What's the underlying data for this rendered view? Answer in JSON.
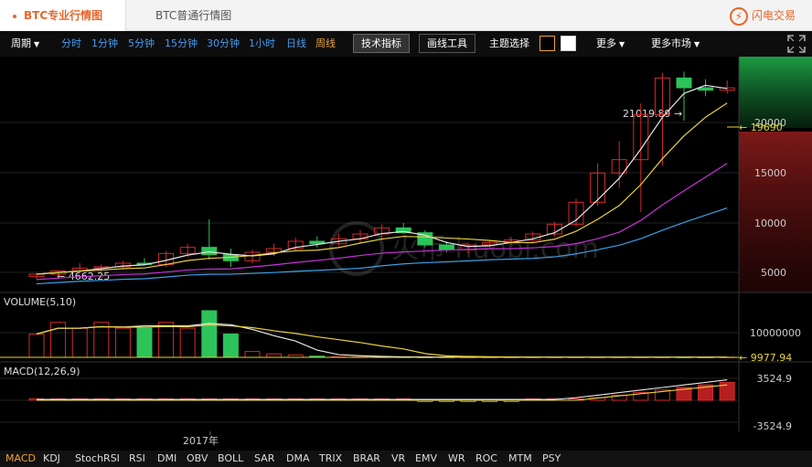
{
  "tabs": {
    "pro": "BTC专业行情图",
    "normal": "BTC普通行情图"
  },
  "flash_trade": {
    "icon": "flash-icon",
    "label": "闪电交易"
  },
  "toolbar": {
    "period_label": "周期",
    "periods": [
      "分时",
      "1分钟",
      "5分钟",
      "15分钟",
      "30分钟",
      "1小时",
      "日线",
      "周线"
    ],
    "active_period": "周线",
    "tech_indicator": "技术指标",
    "draw_tools": "画线工具",
    "theme_label": "主题选择",
    "more": "更多",
    "more_markets": "更多市场"
  },
  "colors": {
    "accent": "#e8662c",
    "up": "#d52a2a",
    "down": "#2cc35a",
    "ma1": "#e8e8e8",
    "ma2": "#e8d23a",
    "ma3": "#c832d8",
    "ma4": "#3aa0e8"
  },
  "price_panel": {
    "high_label": "21019.89",
    "low_label": "4662.25",
    "current_price": "19690",
    "axis_ticks": [
      "20000",
      "15000",
      "10000",
      "5000"
    ],
    "watermark": "火币 huobi.com"
  },
  "volume_panel": {
    "title": "VOLUME(5,10)",
    "axis_ticks": [
      "10000000"
    ],
    "current": "9977.94"
  },
  "macd_panel": {
    "title": "MACD(12,26,9)",
    "axis_ticks": [
      "3524.9",
      "-3524.9"
    ]
  },
  "time_axis": {
    "label": "2017年"
  },
  "indicators": [
    "MACD",
    "KDJ",
    "StochRSI",
    "RSI",
    "DMI",
    "OBV",
    "BOLL",
    "SAR",
    "DMA",
    "TRIX",
    "BRAR",
    "VR",
    "EMV",
    "WR",
    "ROC",
    "MTM",
    "PSY"
  ],
  "active_indicator": "MACD",
  "chart_data": {
    "type": "candlestick",
    "interval": "周线",
    "y_range": [
      3500,
      21500
    ],
    "candles": [
      {
        "o": 4200,
        "h": 4500,
        "l": 4000,
        "c": 4400
      },
      {
        "o": 4400,
        "h": 4700,
        "l": 4200,
        "c": 4662
      },
      {
        "o": 4662,
        "h": 5300,
        "l": 4500,
        "c": 4900
      },
      {
        "o": 4900,
        "h": 5200,
        "l": 4600,
        "c": 5000
      },
      {
        "o": 5000,
        "h": 5500,
        "l": 4800,
        "c": 5300
      },
      {
        "o": 5300,
        "h": 5700,
        "l": 5100,
        "c": 5200
      },
      {
        "o": 5200,
        "h": 6300,
        "l": 5000,
        "c": 6100
      },
      {
        "o": 6100,
        "h": 6900,
        "l": 5800,
        "c": 6600
      },
      {
        "o": 6600,
        "h": 8900,
        "l": 5600,
        "c": 6000
      },
      {
        "o": 6000,
        "h": 6500,
        "l": 5000,
        "c": 5500
      },
      {
        "o": 5500,
        "h": 6400,
        "l": 5300,
        "c": 6200
      },
      {
        "o": 6200,
        "h": 6900,
        "l": 5900,
        "c": 6500
      },
      {
        "o": 6500,
        "h": 7400,
        "l": 6300,
        "c": 7100
      },
      {
        "o": 7100,
        "h": 7500,
        "l": 6600,
        "c": 6900
      },
      {
        "o": 6900,
        "h": 7700,
        "l": 6700,
        "c": 7300
      },
      {
        "o": 7300,
        "h": 8000,
        "l": 7000,
        "c": 7700
      },
      {
        "o": 7700,
        "h": 8500,
        "l": 7200,
        "c": 8200
      },
      {
        "o": 8200,
        "h": 8600,
        "l": 7700,
        "c": 7800
      },
      {
        "o": 7800,
        "h": 8000,
        "l": 6600,
        "c": 6800
      },
      {
        "o": 6800,
        "h": 7100,
        "l": 6200,
        "c": 6400
      },
      {
        "o": 6400,
        "h": 7000,
        "l": 6100,
        "c": 6800
      },
      {
        "o": 6800,
        "h": 7200,
        "l": 6500,
        "c": 7000
      },
      {
        "o": 7000,
        "h": 7400,
        "l": 6800,
        "c": 7200
      },
      {
        "o": 7200,
        "h": 7900,
        "l": 7000,
        "c": 7700
      },
      {
        "o": 7700,
        "h": 8700,
        "l": 7500,
        "c": 8500
      },
      {
        "o": 8500,
        "h": 10600,
        "l": 8300,
        "c": 10300
      },
      {
        "o": 10300,
        "h": 13500,
        "l": 10000,
        "c": 12700
      },
      {
        "o": 12700,
        "h": 15300,
        "l": 11500,
        "c": 13800
      },
      {
        "o": 13800,
        "h": 18400,
        "l": 9500,
        "c": 17500
      },
      {
        "o": 17500,
        "h": 20900,
        "l": 13300,
        "c": 20500
      },
      {
        "o": 20500,
        "h": 21019,
        "l": 17000,
        "c": 19700
      },
      {
        "o": 19700,
        "h": 20400,
        "l": 19000,
        "c": 19500
      },
      {
        "o": 19500,
        "h": 20300,
        "l": 19200,
        "c": 19690
      }
    ]
  }
}
